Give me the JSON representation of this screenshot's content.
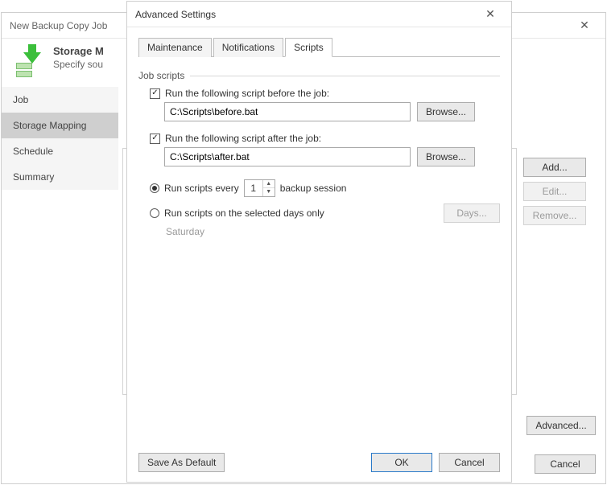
{
  "outer": {
    "title": "New Backup Copy Job",
    "heading": "Storage M",
    "subheading": "Specify sou",
    "steps": [
      "Job",
      "Storage Mapping",
      "Schedule",
      "Summary"
    ],
    "active_step_index": 1,
    "buttons": {
      "add": "Add...",
      "edit": "Edit...",
      "remove": "Remove...",
      "advanced": "Advanced...",
      "cancel": "Cancel"
    }
  },
  "inner": {
    "title": "Advanced Settings",
    "tabs": [
      "Maintenance",
      "Notifications",
      "Scripts"
    ],
    "active_tab_index": 2,
    "fieldset_legend": "Job scripts",
    "before": {
      "checked": true,
      "label": "Run the following script before the job:",
      "value": "C:\\Scripts\\before.bat",
      "browse": "Browse..."
    },
    "after": {
      "checked": true,
      "label": "Run the following script after the job:",
      "value": "C:\\Scripts\\after.bat",
      "browse": "Browse..."
    },
    "frequency": {
      "mode": "every",
      "every_prefix": "Run scripts every",
      "every_value": "1",
      "every_suffix": "backup session",
      "days_label": "Run scripts on the selected days only",
      "days_button": "Days...",
      "selected_days_text": "Saturday"
    },
    "footer": {
      "save_default": "Save As Default",
      "ok": "OK",
      "cancel": "Cancel"
    }
  }
}
